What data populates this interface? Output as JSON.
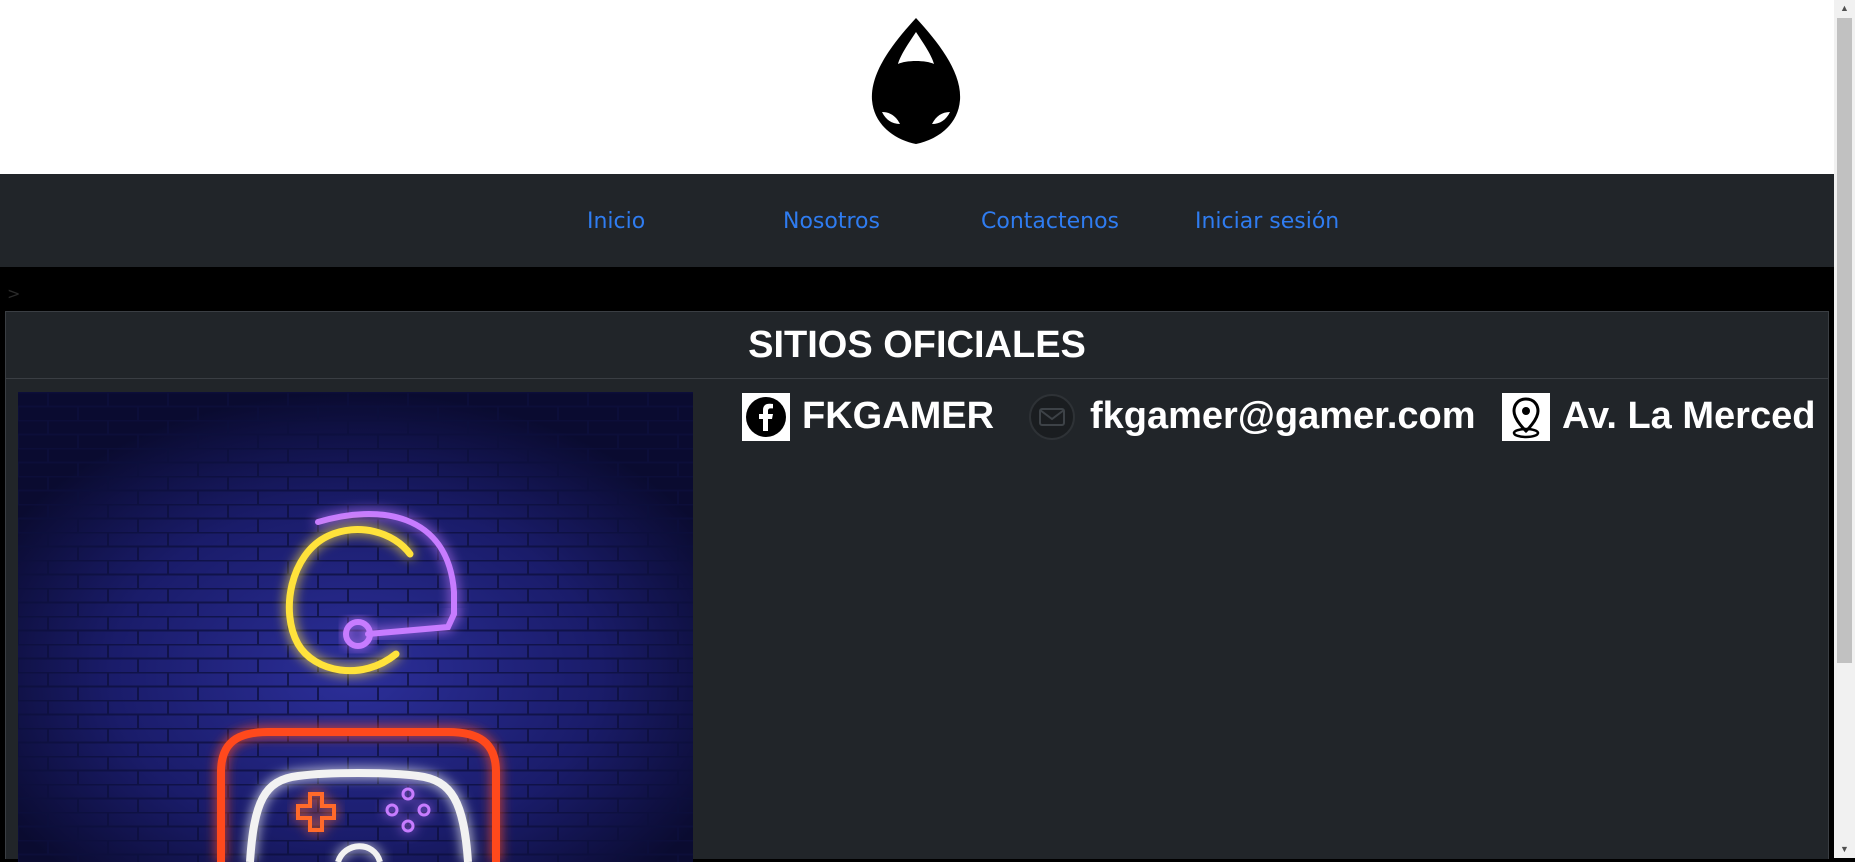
{
  "nav": {
    "items": [
      {
        "label": "Inicio"
      },
      {
        "label": "Nosotros"
      },
      {
        "label": "Contactenos"
      },
      {
        "label": "Iniciar sesión"
      }
    ]
  },
  "breadcrumb_text": ">",
  "section": {
    "title": "SITIOS OFICIALES"
  },
  "contacts": [
    {
      "icon": "facebook-icon",
      "text": "FKGAMER"
    },
    {
      "icon": "email-icon",
      "text": "fkgamer@gamer.com"
    },
    {
      "icon": "location-pin-icon",
      "text": "Av. La Merced"
    }
  ],
  "colors": {
    "nav_bg": "#212529",
    "link": "#2f7cf0",
    "page_bg": "#000000",
    "text": "#ffffff"
  }
}
